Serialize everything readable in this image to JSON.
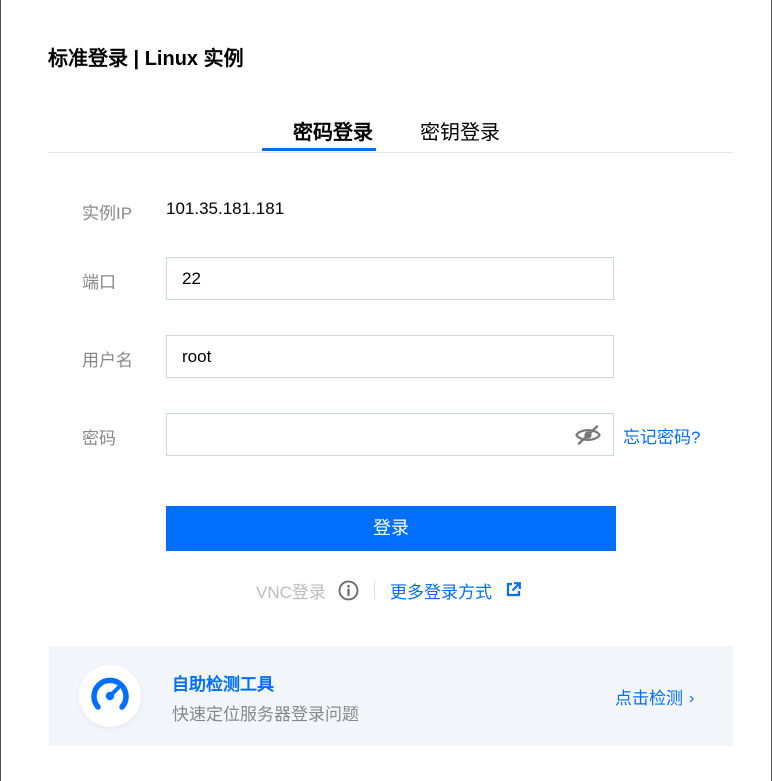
{
  "title": "标准登录 | Linux 实例",
  "tabs": [
    {
      "label": "密码登录",
      "active": true
    },
    {
      "label": "密钥登录",
      "active": false
    }
  ],
  "form": {
    "ip_label": "实例IP",
    "ip_value": "101.35.181.181",
    "port_label": "端口",
    "port_value": "22",
    "user_label": "用户名",
    "user_value": "root",
    "password_label": "密码",
    "password_value": "",
    "forgot_label": "忘记密码?",
    "login_label": "登录"
  },
  "alt_login": {
    "vnc_label": "VNC登录",
    "more_label": "更多登录方式"
  },
  "banner": {
    "title": "自助检测工具",
    "subtitle": "快速定位服务器登录问题",
    "link_label": "点击检测",
    "chevron": "›"
  },
  "icons": {
    "eye": "eye-off-icon",
    "info": "info-circle-icon",
    "external": "external-link-icon",
    "gauge": "gauge-icon"
  },
  "colors": {
    "accent": "#006eff",
    "label": "#888888",
    "banner_bg": "#f2f6fb"
  }
}
